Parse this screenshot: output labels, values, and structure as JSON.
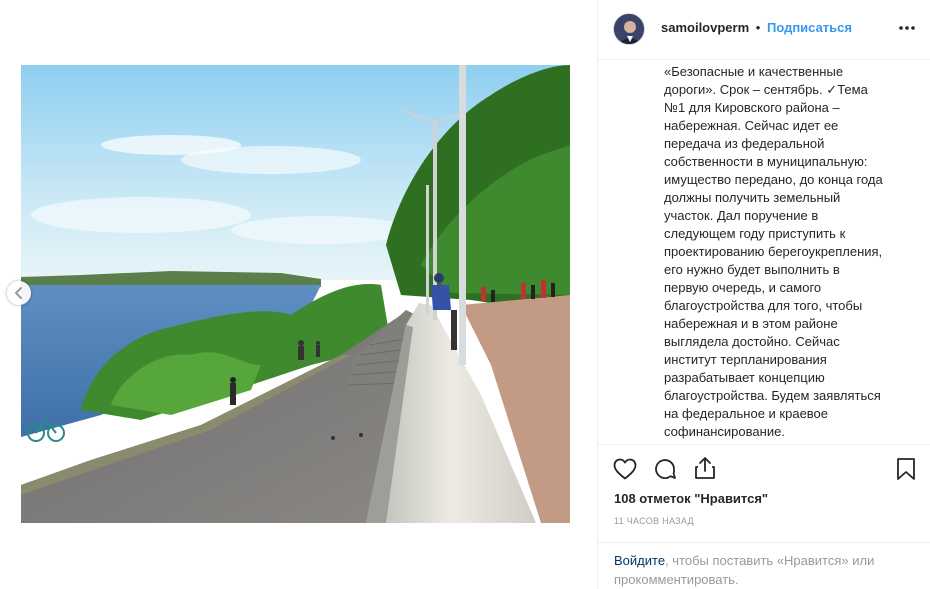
{
  "post": {
    "username": "samoilovperm",
    "separator": "•",
    "follow_label": "Подписаться",
    "more_icon": "more-options-icon",
    "caption": "«Безопасные и качественные\nдороги». Срок – сентябрь. ✓Тема\n№1 для Кировского района –\nнабережная. Сейчас идет ее\nпередача из федеральной\nсобственности в муниципальную:\nимущество передано, до конца года\nдолжны получить земельный\nучасток. Дал поручение в\nследующем году приступить к\nпроектированию берегоукрепления,\nего нужно будет выполнить в\nпервую очередь, и самого\nблагоустройства для того, чтобы\nнабережная и в этом районе\nвыглядела достойно. Сейчас\nинститут терпланирования\nразрабатывает концепцию\nблагоустройства. Будем заявляться\nна федеральное и краевое\nсофинансирование.",
    "likes_text": "108 отметок \"Нравится\"",
    "time_text": "11 часов назад",
    "login_link": "Войдите",
    "login_rest": ", чтобы поставить «Нравится» или прокомментировать."
  },
  "icons": {
    "like": "heart-icon",
    "comment": "comment-icon",
    "share": "share-icon",
    "save": "bookmark-icon",
    "prev": "chevron-left-icon"
  },
  "colors": {
    "link_blue": "#3897f0",
    "text": "#262626",
    "muted": "#999999",
    "border": "#efefef"
  }
}
